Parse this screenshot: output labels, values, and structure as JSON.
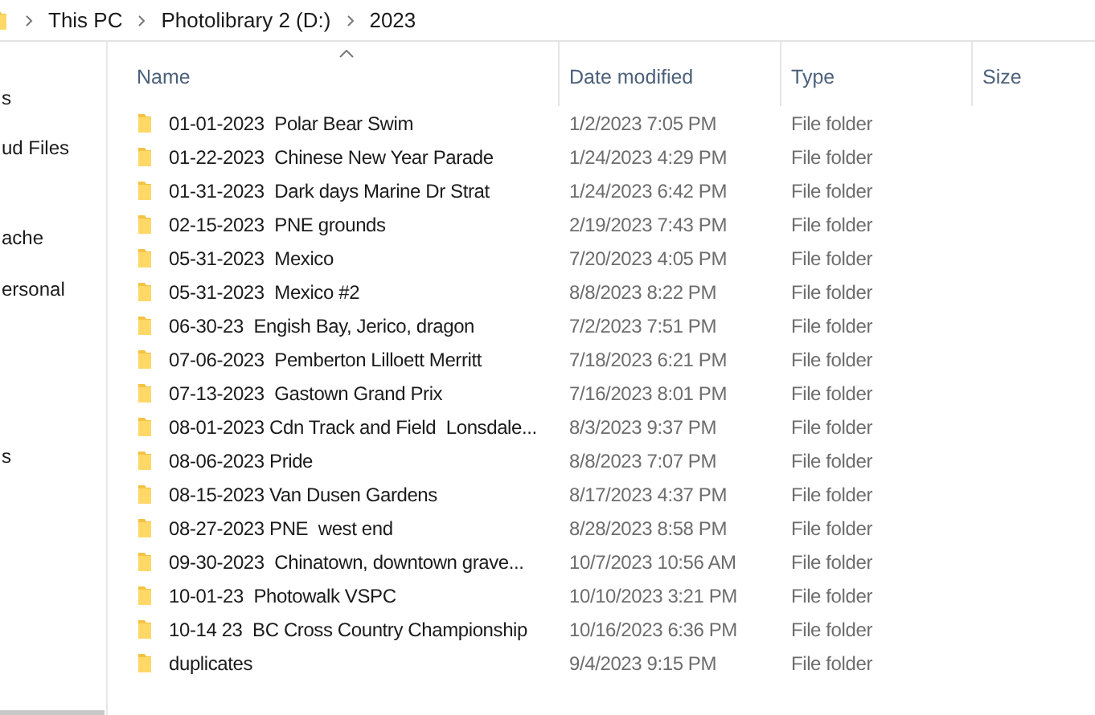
{
  "breadcrumb": [
    "This PC",
    "Photolibrary 2 (D:)",
    "2023"
  ],
  "sidebar": {
    "items": [
      {
        "label": "s"
      },
      {
        "label": "ud Files"
      },
      {
        "label": "ache"
      },
      {
        "label": "ersonal"
      },
      {
        "label": "s"
      }
    ]
  },
  "table": {
    "columns": [
      {
        "label": "Name",
        "sorted": true
      },
      {
        "label": "Date modified",
        "sorted": false
      },
      {
        "label": "Type",
        "sorted": false
      },
      {
        "label": "Size",
        "sorted": false
      }
    ],
    "rows": [
      {
        "name": "01-01-2023  Polar Bear Swim",
        "date": "1/2/2023 7:05 PM",
        "type": "File folder"
      },
      {
        "name": "01-22-2023  Chinese New Year Parade",
        "date": "1/24/2023 4:29 PM",
        "type": "File folder"
      },
      {
        "name": "01-31-2023  Dark days Marine Dr Strat",
        "date": "1/24/2023 6:42 PM",
        "type": "File folder"
      },
      {
        "name": "02-15-2023  PNE grounds",
        "date": "2/19/2023 7:43 PM",
        "type": "File folder"
      },
      {
        "name": "05-31-2023  Mexico",
        "date": "7/20/2023 4:05 PM",
        "type": "File folder"
      },
      {
        "name": "05-31-2023  Mexico #2",
        "date": "8/8/2023 8:22 PM",
        "type": "File folder"
      },
      {
        "name": "06-30-23  Engish Bay, Jerico, dragon",
        "date": "7/2/2023 7:51 PM",
        "type": "File folder"
      },
      {
        "name": "07-06-2023  Pemberton Lilloett Merritt",
        "date": "7/18/2023 6:21 PM",
        "type": "File folder"
      },
      {
        "name": "07-13-2023  Gastown Grand Prix",
        "date": "7/16/2023 8:01 PM",
        "type": "File folder"
      },
      {
        "name": "08-01-2023 Cdn Track and Field  Lonsdale...",
        "date": "8/3/2023 9:37 PM",
        "type": "File folder"
      },
      {
        "name": "08-06-2023 Pride",
        "date": "8/8/2023 7:07 PM",
        "type": "File folder"
      },
      {
        "name": "08-15-2023 Van Dusen Gardens",
        "date": "8/17/2023 4:37 PM",
        "type": "File folder"
      },
      {
        "name": "08-27-2023 PNE  west end",
        "date": "8/28/2023 8:58 PM",
        "type": "File folder"
      },
      {
        "name": "09-30-2023  Chinatown, downtown grave...",
        "date": "10/7/2023 10:56 AM",
        "type": "File folder"
      },
      {
        "name": "10-01-23  Photowalk VSPC",
        "date": "10/10/2023 3:21 PM",
        "type": "File folder"
      },
      {
        "name": "10-14 23  BC Cross Country Championship",
        "date": "10/16/2023 6:36 PM",
        "type": "File folder"
      },
      {
        "name": "duplicates",
        "date": "9/4/2023 9:15 PM",
        "type": "File folder"
      }
    ]
  }
}
